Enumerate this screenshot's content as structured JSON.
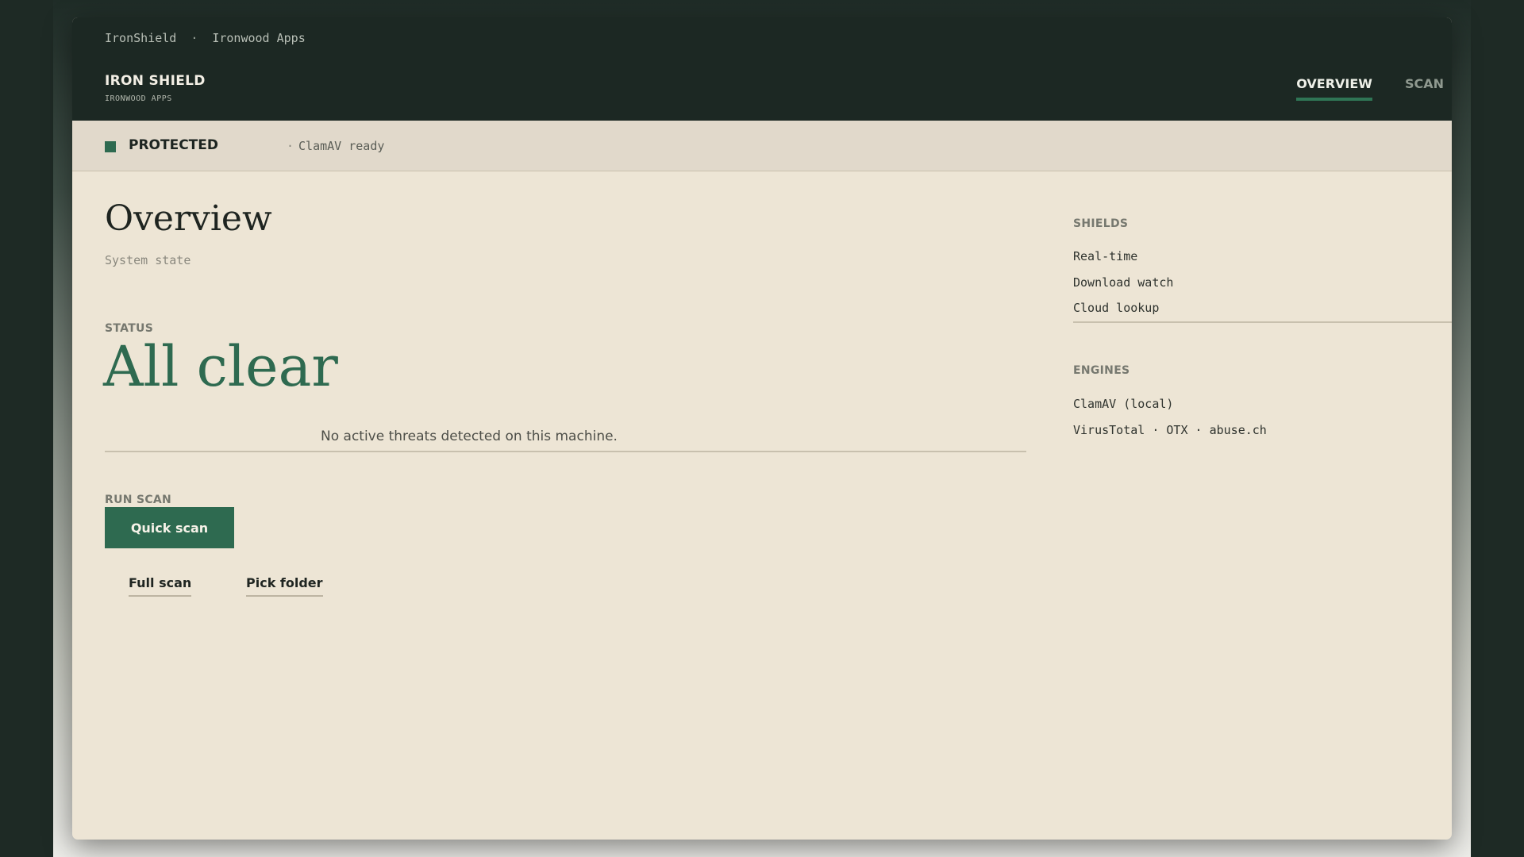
{
  "window": {
    "breadcrumb": [
      "IronShield",
      "Ironwood Apps"
    ],
    "breadcrumb_sep": "·",
    "brand_title": "IRON SHIELD",
    "brand_subtitle": "IRONWOOD APPS"
  },
  "tabs": [
    {
      "label": "OVERVIEW",
      "active": true
    },
    {
      "label": "SCAN",
      "active": false
    }
  ],
  "status_bar": {
    "label": "PROTECTED",
    "separator": "·",
    "text": "ClamAV ready",
    "color": "#2e6a50"
  },
  "main": {
    "title": "Overview",
    "subtitle": "System state",
    "status_label": "STATUS",
    "status_value": "All clear",
    "status_description": "No active threats detected on this machine.",
    "run_scan_label": "RUN SCAN",
    "quick_scan_label": "Quick scan",
    "full_scan_label": "Full scan",
    "pick_folder_label": "Pick folder"
  },
  "sidebar": {
    "shields_label": "SHIELDS",
    "shields": [
      "Real-time",
      "Download watch",
      "Cloud lookup"
    ],
    "engines_label": "ENGINES",
    "engines": [
      "ClamAV (local)",
      "VirusTotal · OTX · abuse.ch"
    ]
  },
  "colors": {
    "accent": "#2e6a50",
    "titlebar": "#1c2823",
    "surface": "#ede5d5"
  }
}
